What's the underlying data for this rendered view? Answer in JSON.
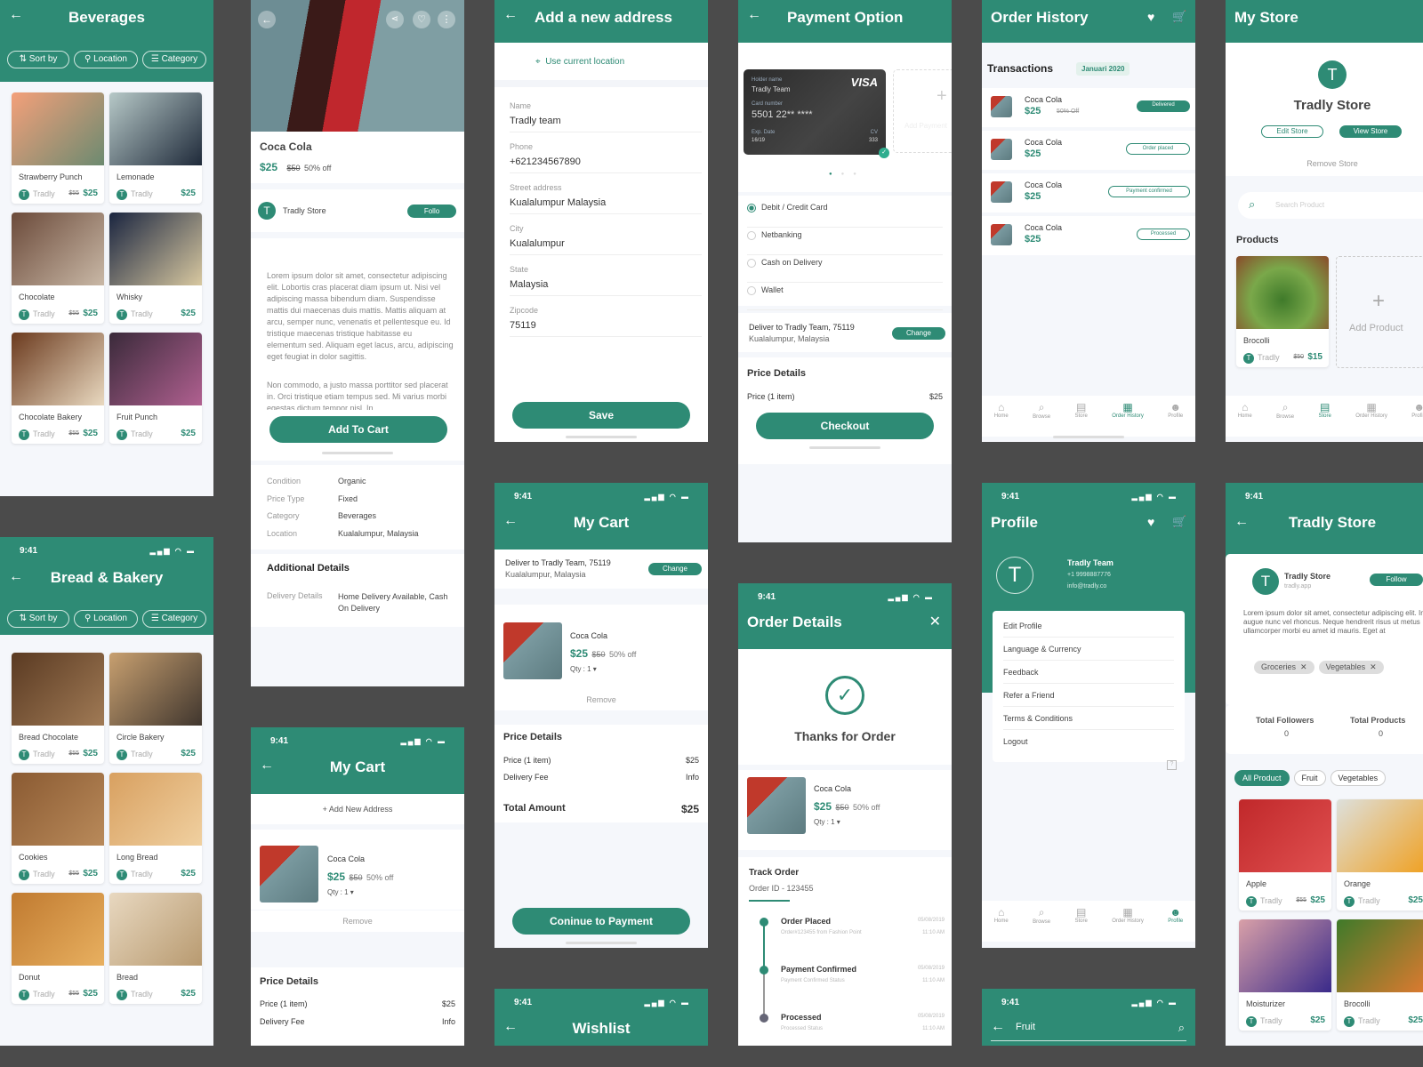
{
  "colors": {
    "primary": "#2e8b75",
    "background": "#4b4b4b",
    "surface": "#f5f7fb"
  },
  "status_time": "9:41",
  "filters": [
    "Sort by",
    "Location",
    "Category"
  ],
  "beverages": {
    "title": "Beverages",
    "products": [
      {
        "name": "Strawberry Punch",
        "store": "Tradly",
        "old_price": "$55",
        "price": "$25"
      },
      {
        "name": "Lemonade",
        "store": "Tradly",
        "old_price": "",
        "price": "$25"
      },
      {
        "name": "Chocolate",
        "store": "Tradly",
        "old_price": "$55",
        "price": "$25"
      },
      {
        "name": "Whisky",
        "store": "Tradly",
        "old_price": "",
        "price": "$25"
      },
      {
        "name": "Chocolate Bakery",
        "store": "Tradly",
        "old_price": "$55",
        "price": "$25"
      },
      {
        "name": "Fruit Punch",
        "store": "Tradly",
        "old_price": "",
        "price": "$25"
      }
    ]
  },
  "bakery": {
    "title": "Bread & Bakery",
    "products": [
      {
        "name": "Bread Chocolate",
        "store": "Tradly",
        "old_price": "$55",
        "price": "$25"
      },
      {
        "name": "Circle Bakery",
        "store": "Tradly",
        "old_price": "",
        "price": "$25"
      },
      {
        "name": "Cookies",
        "store": "Tradly",
        "old_price": "$55",
        "price": "$25"
      },
      {
        "name": "Long Bread",
        "store": "Tradly",
        "old_price": "",
        "price": "$25"
      },
      {
        "name": "Donut",
        "store": "Tradly",
        "old_price": "$55",
        "price": "$25"
      },
      {
        "name": "Bread",
        "store": "Tradly",
        "old_price": "",
        "price": "$25"
      }
    ]
  },
  "product_detail": {
    "name": "Coca Cola",
    "price": "$25",
    "old_price": "$50",
    "discount": "50% off",
    "store": "Tradly Store",
    "follow": "Follo",
    "description": [
      "Lorem ipsum dolor sit amet, consectetur adipiscing elit. Lobortis cras placerat diam ipsum ut. Nisi vel adipiscing massa bibendum diam. Suspendisse mattis dui maecenas duis mattis. Mattis aliquam at arcu, semper nunc, venenatis et pellentesque eu. Id tristique maecenas tristique habitasse eu elementum sed. Aliquam eget lacus, arcu, adipiscing eget feugiat in dolor sagittis.",
      "Non commodo, a justo massa porttitor sed placerat in. Orci tristique etiam tempus sed. Mi varius morbi egestas dictum tempor nisl. In"
    ],
    "add_to_cart": "Add To Cart",
    "details": [
      {
        "label": "Condition",
        "value": "Organic"
      },
      {
        "label": "Price Type",
        "value": "Fixed"
      },
      {
        "label": "Category",
        "value": "Beverages"
      },
      {
        "label": "Location",
        "value": "Kualalumpur, Malaysia"
      }
    ],
    "additional_title": "Additional Details",
    "delivery_label": "Delivery Details",
    "delivery_value": "Home Delivery Available, Cash On Delivery"
  },
  "cart_item": {
    "name": "Coca Cola",
    "price": "$25",
    "old_price": "$50",
    "discount": "50% off",
    "qty": "Qty : 1",
    "remove": "Remove"
  },
  "cart_small": {
    "title": "My Cart",
    "add_address": "+ Add New Address",
    "price_details": "Price Details",
    "price_label": "Price (1 item)",
    "price_value": "$25",
    "delivery_label": "Delivery Fee",
    "delivery_value": "Info"
  },
  "address": {
    "title": "Add a new address",
    "use_current": "Use current location",
    "fields": [
      {
        "label": "Name",
        "value": "Tradly team"
      },
      {
        "label": "Phone",
        "value": "+621234567890"
      },
      {
        "label": "Street address",
        "value": "Kualalumpur Malaysia"
      },
      {
        "label": "City",
        "value": "Kualalumpur"
      },
      {
        "label": "State",
        "value": "Malaysia"
      },
      {
        "label": "Zipcode",
        "value": "75119"
      }
    ],
    "save": "Save"
  },
  "deliver": {
    "line1": "Deliver to Tradly Team, 75119",
    "line2": "Kualalumpur, Malaysia",
    "change": "Change"
  },
  "cart": {
    "title": "My Cart",
    "price_details": "Price Details",
    "price_label": "Price (1 item)",
    "price_value": "$25",
    "delivery_label": "Delivery Fee",
    "delivery_value": "Info",
    "total_label": "Total Amount",
    "total_value": "$25",
    "continue": "Coninue to Payment"
  },
  "wishlist": {
    "title": "Wishlist"
  },
  "payment": {
    "title": "Payment Option",
    "card": {
      "holder_label": "Holder name",
      "holder": "Tradly Team",
      "number_label": "Card number",
      "number": "5501 22** ****",
      "exp_label": "Exp. Date",
      "exp": "16/19",
      "cv_label": "CV",
      "cv": "333",
      "brand": "VISA"
    },
    "add_payment": "Add Payment",
    "options": [
      {
        "label": "Debit / Credit Card",
        "selected": true
      },
      {
        "label": "Netbanking",
        "selected": false
      },
      {
        "label": "Cash on Delivery",
        "selected": false
      },
      {
        "label": "Wallet",
        "selected": false
      }
    ],
    "price_details": "Price Details",
    "price_label": "Price (1 item)",
    "price_value": "$25",
    "checkout": "Checkout"
  },
  "order_details": {
    "title": "Order Details",
    "thanks": "Thanks for Order",
    "track_title": "Track Order",
    "order_id": "Order ID - 123455",
    "steps": [
      {
        "title": "Order Placed",
        "sub": "Order#123455 from Fashion Point",
        "date": "05/08/2019",
        "time": "11:10 AM"
      },
      {
        "title": "Payment Confirmed",
        "sub": "Payment Confirmed Status",
        "date": "05/08/2019",
        "time": "11:10 AM"
      },
      {
        "title": "Processed",
        "sub": "Processed Status",
        "date": "05/08/2019",
        "time": "11:10 AM"
      }
    ]
  },
  "order_history": {
    "title": "Order History",
    "transactions": "Transactions",
    "month": "Januari 2020",
    "items": [
      {
        "name": "Coca Cola",
        "price": "$25",
        "discount": "50% Off",
        "status": "Delivered",
        "filled": true
      },
      {
        "name": "Coca Cola",
        "price": "$25",
        "discount": "",
        "status": "Order placed",
        "filled": false
      },
      {
        "name": "Coca Cola",
        "price": "$25",
        "discount": "",
        "status": "Payment confirmed",
        "filled": false
      },
      {
        "name": "Coca Cola",
        "price": "$25",
        "discount": "",
        "status": "Processed",
        "filled": false
      }
    ]
  },
  "nav": [
    "Home",
    "Browse",
    "Store",
    "Order History",
    "Profile"
  ],
  "profile": {
    "title": "Profile",
    "name": "Tradly Team",
    "phone": "+1 9998887776",
    "email": "info@tradly.co",
    "menu": [
      "Edit Profile",
      "Language & Currency",
      "Feedback",
      "Refer a Friend",
      "Terms & Conditions"
    ],
    "logout": "Logout"
  },
  "fruit": {
    "title": "Fruit"
  },
  "my_store": {
    "title": "My Store",
    "avatar": "T",
    "name": "Tradly Store",
    "edit": "Edit Store",
    "view": "View Store",
    "remove": "Remove Store",
    "search_placeholder": "Search Product",
    "products_title": "Products",
    "product": {
      "name": "Brocolli",
      "store": "Tradly",
      "old_price": "$50",
      "price": "$15"
    },
    "add_product": "Add Product"
  },
  "tradly_store": {
    "title": "Tradly Store",
    "name": "Tradly Store",
    "url": "tradly.app",
    "follow": "Follow",
    "description": "Lorem ipsum dolor sit amet, consectetur adipiscing elit. In augue nunc vel rhoncus. Neque hendrerit risus ut metus ullamcorper morbi eu amet id mauris. Eget at",
    "tags": [
      "Groceries",
      "Vegetables"
    ],
    "followers_label": "Total Followers",
    "followers": "0",
    "products_label": "Total Products",
    "products_count": "0",
    "chips": [
      "All Product",
      "Fruit",
      "Vegetables"
    ],
    "products": [
      {
        "name": "Apple",
        "store": "Tradly",
        "old_price": "$55",
        "price": "$25"
      },
      {
        "name": "Orange",
        "store": "Tradly",
        "old_price": "",
        "price": "$25"
      },
      {
        "name": "Moisturizer",
        "store": "Tradly",
        "old_price": "",
        "price": "$25"
      },
      {
        "name": "Brocolli",
        "store": "Tradly",
        "old_price": "",
        "price": "$25"
      }
    ]
  }
}
